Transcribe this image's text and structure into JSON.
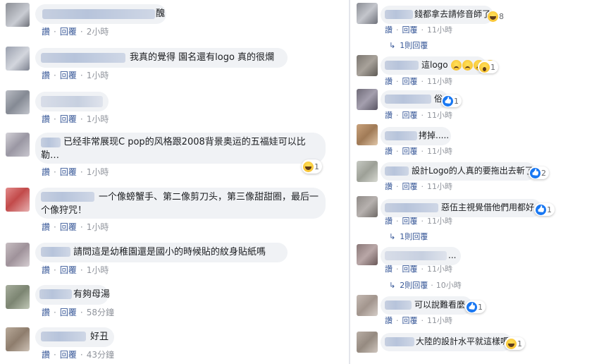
{
  "actions": {
    "like": "讚",
    "reply": "回覆",
    "sep": "·"
  },
  "colors": {
    "bubble": "#f0f2f5",
    "link": "#385898",
    "muted": "#90949c",
    "like_blue": "#1877f2"
  },
  "left_comments": [
    {
      "text": "醜",
      "time": "2小時"
    },
    {
      "text": "我真的覺得 園名還有logo 真的很爛",
      "time": "1小時"
    },
    {
      "text": "",
      "time": "1小時"
    },
    {
      "text": "已经非常展现C pop的风格跟2008背景奥运的五福娃可以比勒…",
      "time": "1小時",
      "reaction_icon": "haha",
      "reaction_count": "1"
    },
    {
      "text": "一个像螃蟹手、第二像剪刀头，第三像甜甜圈，最后一个像狩咒！",
      "time": "1小時"
    },
    {
      "text": "請問這是幼稚園還是國小的時候貼的紋身貼紙嗎",
      "time": "1小時"
    },
    {
      "text": "有夠母湯",
      "time": "58分鐘"
    },
    {
      "text": "好丑",
      "time": "43分鐘"
    }
  ],
  "right_comments": [
    {
      "text": "錢都拿去請修音師了",
      "time": "11小時",
      "reaction_icon": "haha",
      "reaction_count": "8",
      "replies": "1則回覆"
    },
    {
      "text": "這logo",
      "time": "11小時",
      "reaction_count": "1"
    },
    {
      "text": "俗",
      "time": "11小時",
      "reaction_icon": "like",
      "reaction_count": "1"
    },
    {
      "text": "拷掉.....",
      "time": "11小時"
    },
    {
      "text": "設計Logo的人真的要拖出去斬了",
      "time": "11小時",
      "reaction_icon": "like",
      "reaction_count": "2"
    },
    {
      "text": "惡伍主視覺借他們用都好",
      "time": "11小時",
      "reaction_icon": "like",
      "reaction_count": "1",
      "replies": "1則回覆"
    },
    {
      "text": "...",
      "time": "11小時",
      "replies": "2則回覆",
      "replies_time": "10小時"
    },
    {
      "text": "可以說難看麼",
      "time": "11小時",
      "reaction_icon": "like",
      "reaction_count": "1"
    },
    {
      "text": "大陸的設計水平就這樣嗎?",
      "time": "",
      "reaction_icon": "haha",
      "reaction_count": "1"
    }
  ]
}
